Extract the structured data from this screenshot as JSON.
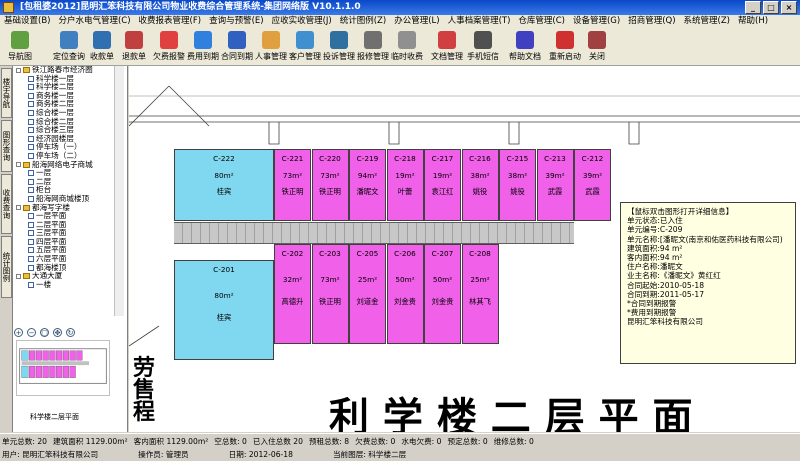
{
  "window": {
    "title": "[包租婆2012]昆明汇笨科技有限公司物业收费综合管理系统-集团网络版 V10.1.1.0"
  },
  "menu": [
    "基础设置(B)",
    "分户水电气管理(C)",
    "收费报表管理(F)",
    "查询与预警(E)",
    "应收实收管理(J)",
    "统计图例(Z)",
    "办公管理(L)",
    "人事档案管理(T)",
    "仓库管理(C)",
    "设备管理(G)",
    "招商管理(Q)",
    "系统管理(Z)",
    "帮助(H)"
  ],
  "toolbar": [
    "导航图",
    "定位查询",
    "收款单",
    "退款单",
    "欠费报警",
    "费用到期",
    "合同到期",
    "人事管理",
    "客户管理",
    "投诉管理",
    "报修管理",
    "临时收费",
    "文档管理",
    "手机短信",
    "帮助文档",
    "重新启动",
    "关闭"
  ],
  "left": {
    "vtabs": [
      "楼宇导航",
      "图形查询",
      "收费查询",
      "统计图例"
    ],
    "tree": [
      "铁江路春市经济圈",
      "科学楼一层",
      "科学楼二层",
      "商务楼一层",
      "商务楼二层",
      "综合楼一层",
      "综合楼二层",
      "综合楼三层",
      "经济园楼层",
      "停车场（一）",
      "停车场（二）",
      "船海网络电子商城",
      "一层",
      "二层",
      "柜台",
      "船海网商城楼顶",
      "都海写字楼",
      "一层平面",
      "二层平面",
      "三层平面",
      "四层平面",
      "五层平面",
      "六层平面",
      "都海楼顶",
      "大通大厦",
      "一楼"
    ],
    "minimap_caption": "科学楼二层平面"
  },
  "rooms_top": [
    {
      "id": "C-222",
      "area": "80m²",
      "tenant": "桂宾",
      "color": "#7fd8f0"
    },
    {
      "id": "C-221",
      "area": "73m²",
      "tenant": "铁正明",
      "color": "#f060e8"
    },
    {
      "id": "C-220",
      "area": "73m²",
      "tenant": "铁正明",
      "color": "#f060e8"
    },
    {
      "id": "C-219",
      "area": "94m²",
      "tenant": "潘昵文",
      "color": "#f060e8"
    },
    {
      "id": "C-218",
      "area": "19m²",
      "tenant": "叶蕾",
      "color": "#f060e8"
    },
    {
      "id": "C-217",
      "area": "19m²",
      "tenant": "袁江红",
      "color": "#f060e8"
    },
    {
      "id": "C-216",
      "area": "38m²",
      "tenant": "姚役",
      "color": "#f060e8"
    },
    {
      "id": "C-215",
      "area": "38m²",
      "tenant": "姚役",
      "color": "#f060e8"
    },
    {
      "id": "C-213",
      "area": "39m²",
      "tenant": "武霞",
      "color": "#f060e8"
    },
    {
      "id": "C-212",
      "area": "39m²",
      "tenant": "武霞",
      "color": "#f060e8"
    }
  ],
  "rooms_bottom": [
    {
      "id": "C-201",
      "area": "80m²",
      "tenant": "桂宾",
      "color": "#7fd8f0"
    },
    {
      "id": "C-202",
      "area": "32m²",
      "tenant": "高德升",
      "color": "#f060e8"
    },
    {
      "id": "C-203",
      "area": "73m²",
      "tenant": "铁正明",
      "color": "#f060e8"
    },
    {
      "id": "C-205",
      "area": "25m²",
      "tenant": "刘道金",
      "color": "#f060e8"
    },
    {
      "id": "C-206",
      "area": "50m²",
      "tenant": "刘金贵",
      "color": "#f060e8"
    },
    {
      "id": "C-207",
      "area": "50m²",
      "tenant": "刘金贵",
      "color": "#f060e8"
    },
    {
      "id": "C-208",
      "area": "25m²",
      "tenant": "林其飞",
      "color": "#f060e8"
    }
  ],
  "plan_text": [
    "劳",
    "售",
    "程"
  ],
  "tooltip": [
    "【鼠标双击图形打开详细信息】",
    "",
    "单元状态:已入住",
    "单元编号:C-209",
    "单元名称:[潘昵文(南京和佑医药科技有限公司)",
    "建筑面积:94 m²",
    "客内面积:94 m²",
    "住户名称:潘昵文",
    "业主名称:《潘昵文》黄红红",
    "合同起始:2010-05-18",
    "合同到期:2011-05-17",
    "",
    "*合同到期报警",
    "*费用到期报警",
    "",
    "昆明汇笨科技有限公司"
  ],
  "status": {
    "row1": [
      "单元总数: 20",
      "建筑面积 1129.00m²",
      "客内面积 1129.00m²",
      "空总数: 0",
      "已入住总数 20",
      "预租总数: 8",
      "欠费总数: 0",
      "水电欠费: 0",
      "预定总数: 0",
      "维修总数: 0"
    ],
    "row2": [
      "用户: 昆明汇笨科技有限公司",
      "操作员: 管理员",
      "日期: 2012-06-18",
      "当前图层: 科学楼二层"
    ]
  }
}
